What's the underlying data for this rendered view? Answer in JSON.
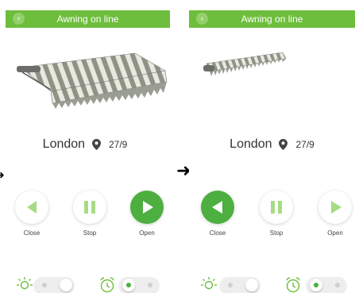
{
  "screens": [
    {
      "header": {
        "title": "Awning on line",
        "back_icon": "chevron-left-icon"
      },
      "location": {
        "city": "London",
        "pin_icon": "location-pin-icon",
        "date": "27/9"
      },
      "awning_extension_percent": 100,
      "buttons": [
        {
          "label": "Close",
          "icon": "triangle-left-icon",
          "active": false
        },
        {
          "label": "Stop",
          "icon": "pause-icon",
          "active": false
        },
        {
          "label": "Open",
          "icon": "triangle-right-icon",
          "active": true
        }
      ],
      "sun_toggle": {
        "icon": "sun-icon",
        "state": "off"
      },
      "timer_toggle": {
        "icon": "alarm-clock-icon",
        "state": "on"
      }
    },
    {
      "header": {
        "title": "Awning on line",
        "back_icon": "chevron-left-icon"
      },
      "location": {
        "city": "London",
        "pin_icon": "location-pin-icon",
        "date": "27/9"
      },
      "awning_extension_percent": 15,
      "buttons": [
        {
          "label": "Close",
          "icon": "triangle-left-icon",
          "active": true
        },
        {
          "label": "Stop",
          "icon": "pause-icon",
          "active": false
        },
        {
          "label": "Open",
          "icon": "triangle-right-icon",
          "active": false
        }
      ],
      "sun_toggle": {
        "icon": "sun-icon",
        "state": "off"
      },
      "timer_toggle": {
        "icon": "alarm-clock-icon",
        "state": "on"
      }
    }
  ],
  "arrow_icon": "right-arrow-icon",
  "colors": {
    "green": "#6dbe3c",
    "active_button": "#4caf3f",
    "inactive_icon": "#a7dc86",
    "stripe_grey": "#8f9386",
    "stripe_light": "#e8eadf"
  }
}
